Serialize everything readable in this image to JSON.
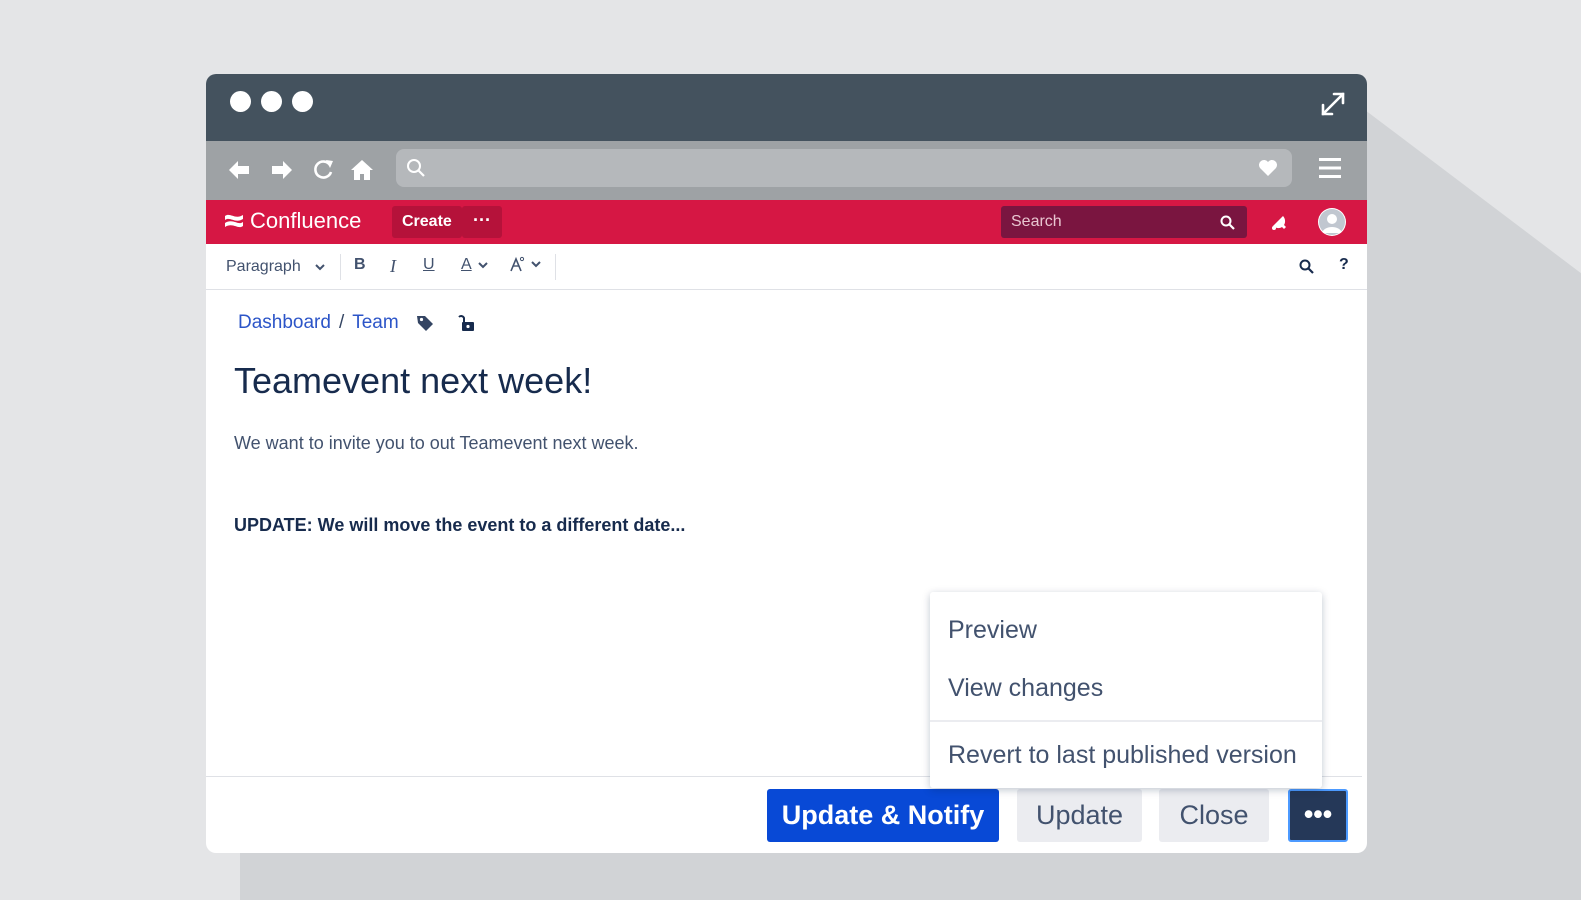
{
  "browser": {
    "window_dots": 3
  },
  "app": {
    "name": "Confluence",
    "create_label": "Create",
    "more_label": "···",
    "search_placeholder": "Search"
  },
  "toolbar": {
    "paragraph_label": "Paragraph",
    "bold_label": "B",
    "italic_label": "I",
    "underline_label": "U",
    "text_color_label": "A",
    "help_label": "?"
  },
  "breadcrumb": {
    "items": [
      "Dashboard",
      "Team"
    ],
    "separator": "/"
  },
  "page": {
    "title": "Teamevent next week!",
    "body": "We want to invite you to out Teamevent next week.",
    "update": "UPDATE: We will move the event to a different date..."
  },
  "dropdown": {
    "items": [
      "Preview",
      "View changes",
      "Revert to last published version"
    ]
  },
  "footer": {
    "update_notify_label": "Update & Notify",
    "update_label": "Update",
    "close_label": "Close",
    "more_label": "•••"
  },
  "colors": {
    "brand": "#d61744",
    "primary": "#0849d6",
    "titlebar": "#44525e"
  }
}
